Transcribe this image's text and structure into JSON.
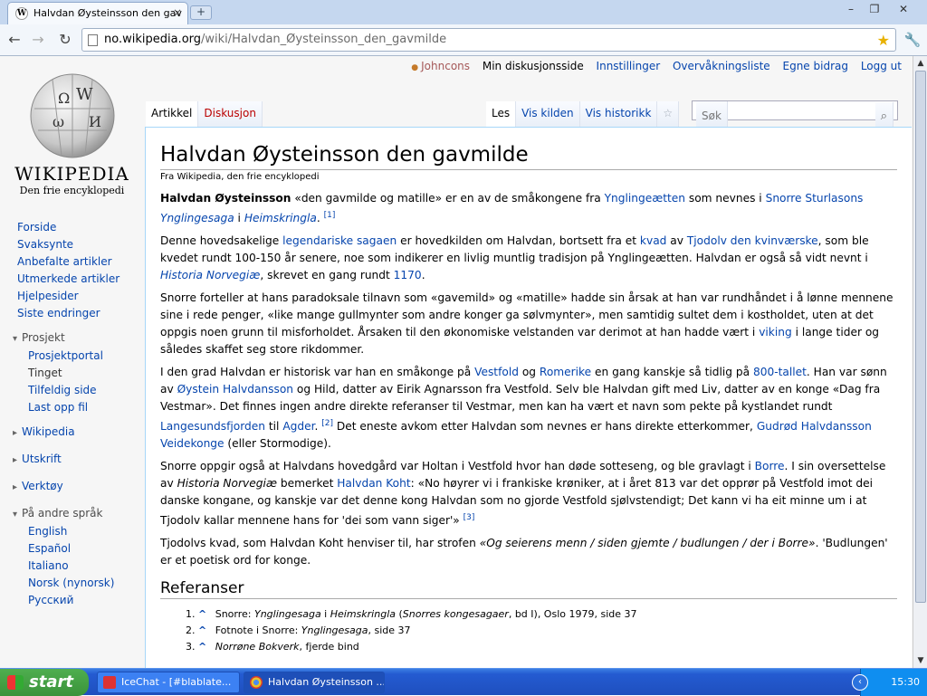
{
  "browser": {
    "tab_title": "Halvdan Øysteinsson den gav",
    "tab_close": "×",
    "new_tab": "+",
    "url_host": "no.wikipedia.org",
    "url_path": "/wiki/Halvdan_Øysteinsson_den_gavmilde",
    "win_min": "–",
    "win_max": "❐",
    "win_close": "✕",
    "back": "←",
    "forward": "→",
    "reload": "↻",
    "star": "★",
    "wrench": "🔧"
  },
  "personal": {
    "user": "Johncons",
    "talk": "Min diskusjonsside",
    "prefs": "Innstillinger",
    "watch": "Overvåkningsliste",
    "contrib": "Egne bidrag",
    "logout": "Logg ut"
  },
  "logo": {
    "name": "WIKIPEDIA",
    "tagline": "Den frie encyklopedi",
    "glyph_omega": "Ω",
    "glyph_w": "W",
    "glyph_i": "И",
    "glyph_w2": "ω"
  },
  "nav": {
    "main": "Forside",
    "recent_dumb": "Svaksynte",
    "featured": "Anbefalte artikler",
    "excellent": "Utmerkede artikler",
    "help": "Hjelpesider",
    "changes": "Siste endringer"
  },
  "project": {
    "title": "Prosjekt",
    "portal": "Prosjektportal",
    "tinget": "Tinget",
    "random": "Tilfeldig side",
    "upload": "Last opp fil"
  },
  "collapsed": {
    "wikipedia": "Wikipedia",
    "print": "Utskrift",
    "tools": "Verktøy"
  },
  "langs": {
    "title": "På andre språk",
    "en": "English",
    "es": "Español",
    "it": "Italiano",
    "nn": "Norsk (nynorsk)",
    "ru": "Русский"
  },
  "tabs": {
    "article": "Artikkel",
    "talk": "Diskusjon",
    "read": "Les",
    "source": "Vis kilden",
    "history": "Vis historikk",
    "watch_star": "☆",
    "search_placeholder": "Søk",
    "search_icon": "⌕"
  },
  "article": {
    "title": "Halvdan Øysteinsson den gavmilde",
    "sitesub": "Fra Wikipedia, den frie encyklopedi",
    "p1": {
      "b": "Halvdan Øysteinsson",
      "t1": " «den gavmilde og matille» er en av de småkongene fra ",
      "l1": "Ynglingeætten",
      "t2": " som nevnes i ",
      "l2": "Snorre Sturlasons ",
      "l2i": "Ynglingesaga",
      "t3": " i ",
      "l3": "Heimskringla",
      "t4": ". ",
      "sup": "[1]"
    },
    "p2": {
      "t1": "Denne hovedsakelige ",
      "l1": "legendariske sagaen",
      "t2": " er hovedkilden om Halvdan, bortsett fra et ",
      "l2": "kvad",
      "t3": " av ",
      "l3": "Tjodolv den kvinværske",
      "t4": ", som ble kvedet rundt 100-150 år senere, noe som indikerer en livlig muntlig tradisjon på Ynglingeætten. Halvdan er også så vidt nevnt i ",
      "l4": "Historia Norvegiæ",
      "t5": ", skrevet en gang rundt ",
      "l5": "1170",
      "t6": "."
    },
    "p3": {
      "t1": "Snorre forteller at hans paradoksale tilnavn som «gavemild» og «matille» hadde sin årsak at han var rundhåndet i å lønne mennene sine i rede penger, «like mange gullmynter som andre konger ga sølvmynter», men samtidig sultet dem i kostholdet, uten at det oppgis noen grunn til misforholdet. Årsaken til den økonomiske velstanden var derimot at han hadde vært i ",
      "l1": "viking",
      "t2": " i lange tider og således skaffet seg store rikdommer."
    },
    "p4": {
      "t1": "I den grad Halvdan er historisk var han en småkonge på ",
      "l1": "Vestfold",
      "t2": " og ",
      "l2": "Romerike",
      "t3": " en gang kanskje så tidlig på ",
      "l3": "800-tallet",
      "t4": ". Han var sønn av ",
      "l4": "Øystein Halvdansson",
      "t5": " og Hild, datter av Eirik Agnarsson fra Vestfold. Selv ble Halvdan gift med Liv, datter av en konge «Dag fra Vestmar». Det finnes ingen andre direkte referanser til Vestmar, men kan ha vært et navn som pekte på kystlandet rundt ",
      "l5": "Langesundsfjorden",
      "t6": " til ",
      "l6": "Agder",
      "t7": ". ",
      "sup": "[2]",
      "t8": " Det eneste avkom etter Halvdan som nevnes er hans direkte etterkommer, ",
      "l7": "Gudrød Halvdansson Veidekonge",
      "t9": " (eller Stormodige)."
    },
    "p5": {
      "t1": "Snorre oppgir også at Halvdans hovedgård var Holtan i Vestfold hvor han døde sotteseng, og ble gravlagt i ",
      "l1": "Borre",
      "t2": ". I sin oversettelse av ",
      "i1": "Historia Norvegiæ",
      "t3": " bemerket ",
      "l2": "Halvdan Koht",
      "t4": ": «No høyrer vi i frankiske krøniker, at i året 813 var det opprør på Vestfold imot dei danske kongane, og kanskje var det denne kong Halvdan som no gjorde Vestfold sjølvstendigt; Det kann vi ha eit minne um i at Tjodolv kallar mennene hans for 'dei som vann siger'» ",
      "sup": "[3]"
    },
    "p6": {
      "t1": "Tjodolvs kvad, som Halvdan Koht henviser til, har strofen ",
      "i1": "«Og seierens menn / siden gjemte / budlungen / der i Borre»",
      "t2": ". 'Budlungen' er et poetisk ord for konge."
    },
    "refs_title": "Referanser",
    "refs": [
      {
        "n": "1.",
        "c": "^",
        "t1": " Snorre: ",
        "i1": "Ynglingesaga",
        "t2": " i ",
        "i2": "Heimskringla",
        "t3": " (",
        "i3": "Snorres kongesagaer",
        "t4": ", bd I), Oslo 1979, side 37"
      },
      {
        "n": "2.",
        "c": "^",
        "t1": " Fotnote i Snorre: ",
        "i1": "Ynglingesaga",
        "t2": ", side 37",
        "i2": "",
        "t3": "",
        "i3": "",
        "t4": ""
      },
      {
        "n": "3.",
        "c": "^",
        "t1": " ",
        "i1": "Norrøne Bokverk",
        "t2": ", fjerde bind",
        "i2": "",
        "t3": "",
        "i3": "",
        "t4": ""
      }
    ]
  },
  "taskbar": {
    "start": "start",
    "task1": "IceChat - [#blablate...",
    "task2": "Halvdan Øysteinsson ...",
    "clock": "15:30",
    "tray_arrow": "‹"
  }
}
